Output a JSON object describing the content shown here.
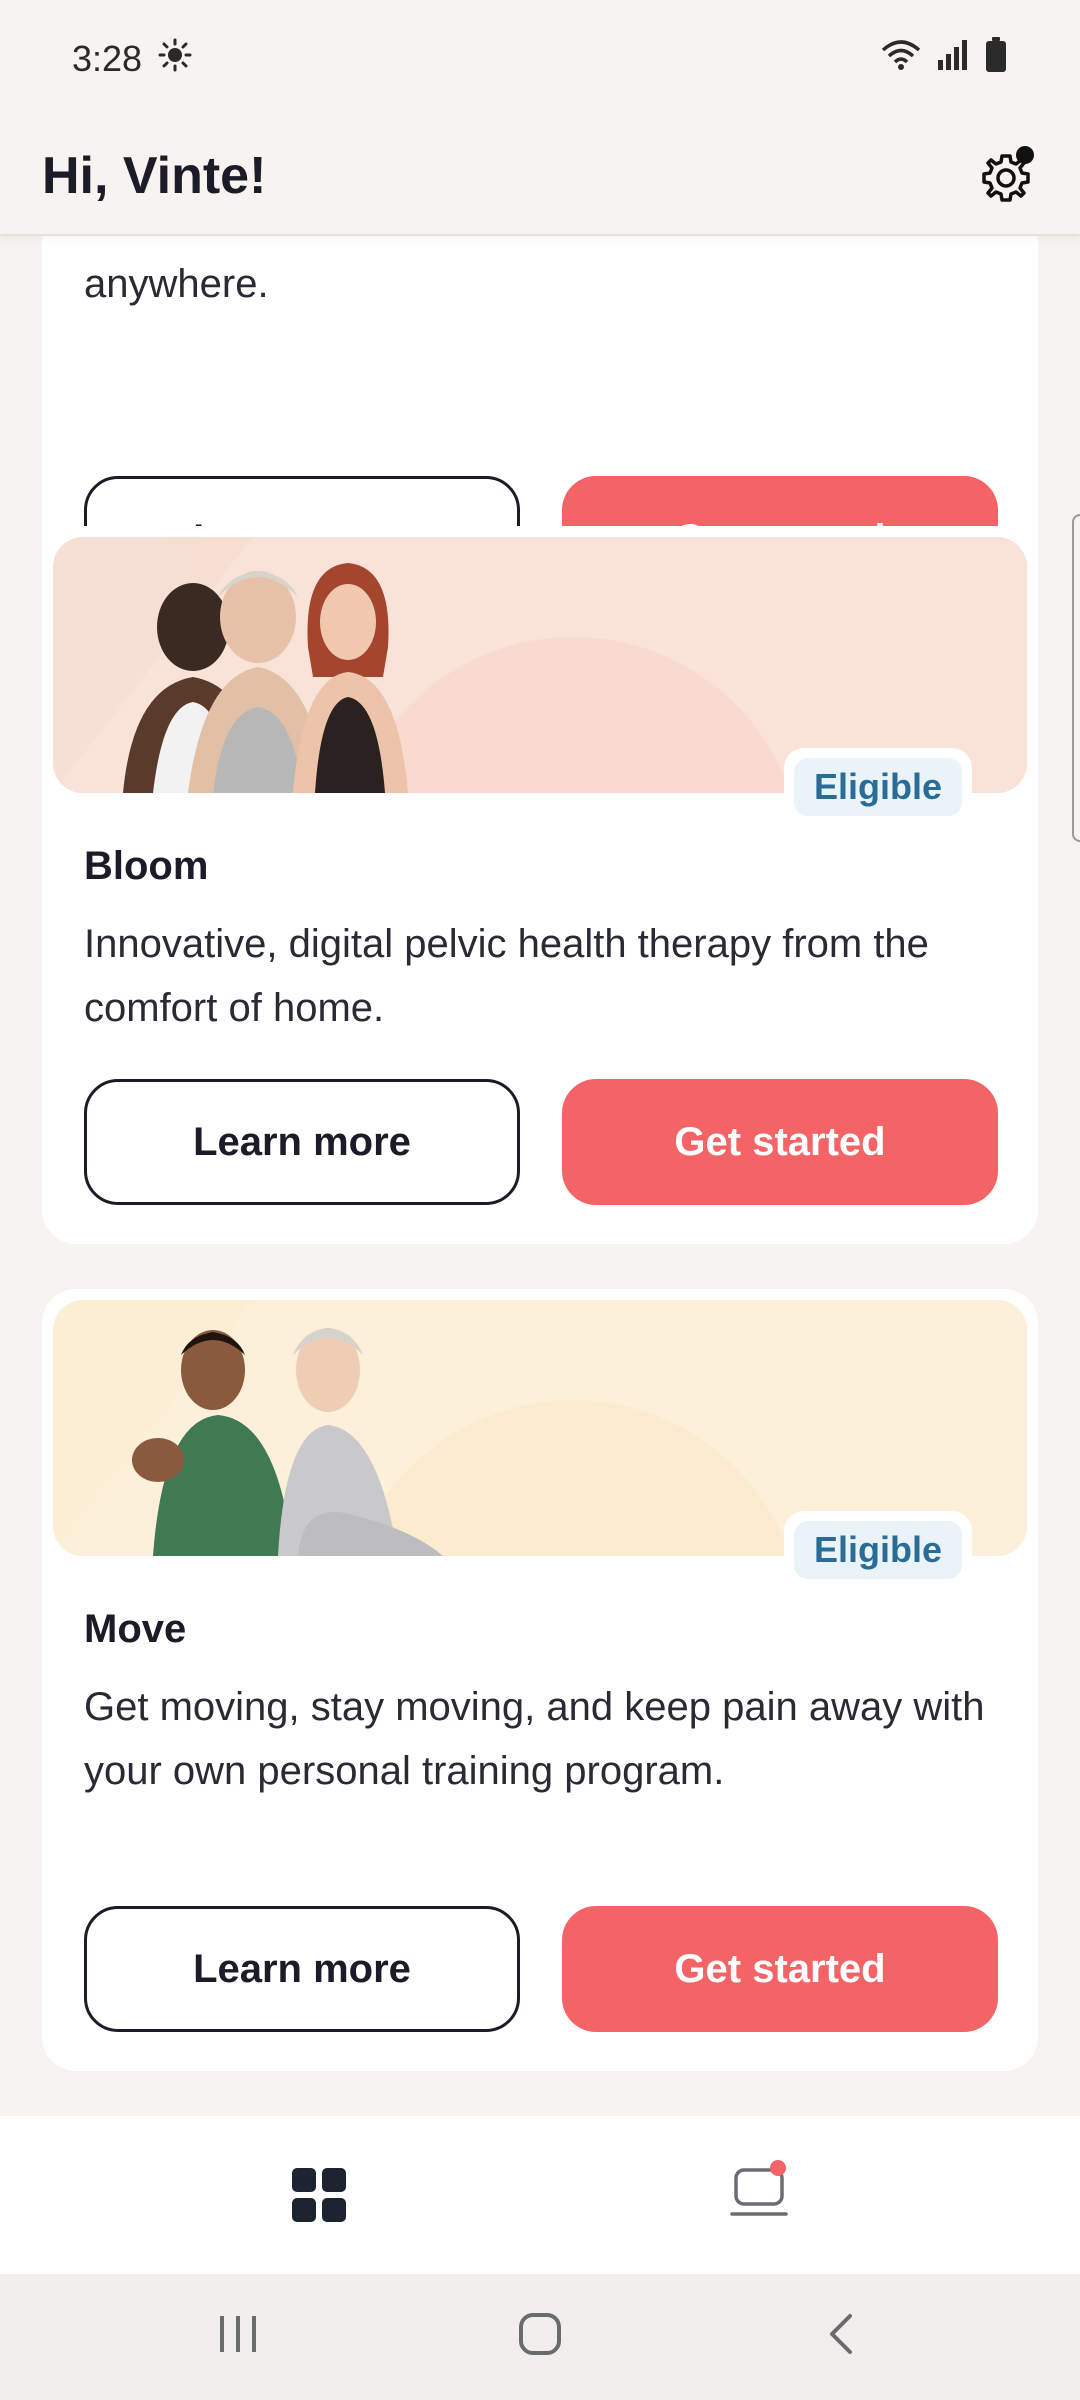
{
  "status_bar": {
    "time": "3:28",
    "left_icon": "brightness-icon",
    "right_icons": [
      "wifi-icon",
      "signal-icon",
      "battery-icon"
    ]
  },
  "header": {
    "title": "Hi, Vinte!",
    "settings_icon": "gear-icon"
  },
  "cards": [
    {
      "fragment_text": "anywhere.",
      "learn_more": "Learn more",
      "get_started": "Get started"
    },
    {
      "badge": "Eligible",
      "title": "Bloom",
      "description": "Innovative, digital pelvic health therapy from the comfort of home.",
      "learn_more": "Learn more",
      "get_started": "Get started"
    },
    {
      "badge": "Eligible",
      "title": "Move",
      "description": "Get moving, stay moving, and keep pain away with your own personal training program.",
      "learn_more": "Learn more",
      "get_started": "Get started"
    }
  ],
  "bottom_nav": {
    "items": [
      "grid-icon",
      "inbox-icon"
    ]
  },
  "colors": {
    "accent": "#f46466",
    "badge_text": "#2a6c96",
    "badge_bg": "#eaf3f8",
    "background": "#f6f3f0"
  }
}
